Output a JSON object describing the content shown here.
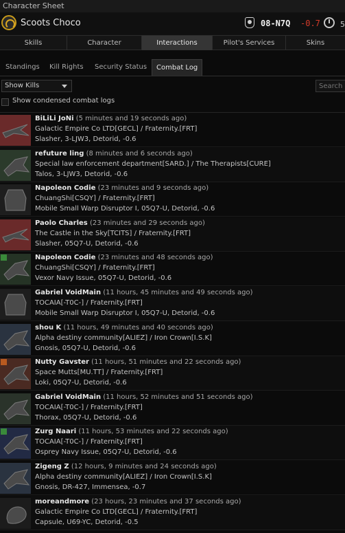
{
  "window": {
    "title": "Character Sheet"
  },
  "header": {
    "character_name": "Scoots Choco",
    "system": "08-N7Q",
    "system_security": "-0.7",
    "clock_value": "5"
  },
  "main_tabs": [
    {
      "label": "Skills",
      "active": false
    },
    {
      "label": "Character",
      "active": false
    },
    {
      "label": "Interactions",
      "active": true
    },
    {
      "label": "Pilot's Services",
      "active": false
    },
    {
      "label": "Skins",
      "active": false
    }
  ],
  "sub_tabs": [
    {
      "label": "Standings",
      "active": false
    },
    {
      "label": "Kill Rights",
      "active": false
    },
    {
      "label": "Security Status",
      "active": false
    },
    {
      "label": "Combat Log",
      "active": true
    }
  ],
  "controls": {
    "filter_value": "Show Kills",
    "search_placeholder": "Search",
    "condensed_label": "Show condensed combat logs",
    "condensed_checked": false
  },
  "kills": [
    {
      "pilot": "BiLiLi JoNi",
      "time": "(5 minutes and 19 seconds ago)",
      "corp": "Galactic Empire Co LTD[GECL] / Fraternity.[FRT]",
      "details": "Slasher, 3-LJW3, Detorid, -0.6",
      "ship_icon": "slasher-ship-icon",
      "tint": "#6a2a2a"
    },
    {
      "pilot": "refuture ling",
      "time": "(8 minutes and 6 seconds ago)",
      "corp": "Special law enforcement department[SARD.] / The Therapists[CURE]",
      "details": "Talos, 3-LJW3, Detorid, -0.6",
      "ship_icon": "talos-ship-icon",
      "tint": "#2b3a2b"
    },
    {
      "pilot": "Napoleon Codie",
      "time": "(23 minutes and 9 seconds ago)",
      "corp": "ChuangShi[CSQY] / Fraternity.[FRT]",
      "details": "Mobile Small Warp Disruptor I, 05Q7-U, Detorid, -0.6",
      "ship_icon": "warp-disruptor-icon",
      "tint": "#1e1e1e"
    },
    {
      "pilot": "Paolo Charles",
      "time": "(23 minutes and 29 seconds ago)",
      "corp": "The Castle in the Sky[TCITS] / Fraternity.[FRT]",
      "details": "Slasher, 05Q7-U, Detorid, -0.6",
      "ship_icon": "slasher-ship-icon",
      "tint": "#6a2a2a"
    },
    {
      "pilot": "Napoleon Codie",
      "time": "(23 minutes and 48 seconds ago)",
      "corp": "ChuangShi[CSQY] / Fraternity.[FRT]",
      "details": "Vexor Navy Issue, 05Q7-U, Detorid, -0.6",
      "ship_icon": "vexor-ship-icon",
      "tint": "#253325",
      "badge": "#3a8a3a"
    },
    {
      "pilot": "Gabriel VoidMain",
      "time": "(11 hours, 45 minutes and 49 seconds ago)",
      "corp": "TOCAIA[-T0C-] / Fraternity.[FRT]",
      "details": "Mobile Small Warp Disruptor I, 05Q7-U, Detorid, -0.6",
      "ship_icon": "warp-disruptor-icon",
      "tint": "#1e1e1e"
    },
    {
      "pilot": "shou K",
      "time": "(11 hours, 49 minutes and 40 seconds ago)",
      "corp": "Alpha destiny community[ALIEZ] / Iron Crown[I.S.K]",
      "details": "Gnosis, 05Q7-U, Detorid, -0.6",
      "ship_icon": "gnosis-ship-icon",
      "tint": "#2a3340"
    },
    {
      "pilot": "Nutty Gavster",
      "time": "(11 hours, 51 minutes and 22 seconds ago)",
      "corp": "Space Mutts[MU.TT] / Fraternity.[FRT]",
      "details": "Loki, 05Q7-U, Detorid, -0.6",
      "ship_icon": "loki-ship-icon",
      "tint": "#4a2a22",
      "badge": "#b85a20"
    },
    {
      "pilot": "Gabriel VoidMain",
      "time": "(11 hours, 52 minutes and 51 seconds ago)",
      "corp": "TOCAIA[-T0C-] / Fraternity.[FRT]",
      "details": "Thorax, 05Q7-U, Detorid, -0.6",
      "ship_icon": "thorax-ship-icon",
      "tint": "#2a332a"
    },
    {
      "pilot": "Zurg Naari",
      "time": "(11 hours, 53 minutes and 22 seconds ago)",
      "corp": "TOCAIA[-T0C-] / Fraternity.[FRT]",
      "details": "Osprey Navy Issue, 05Q7-U, Detorid, -0.6",
      "ship_icon": "osprey-ship-icon",
      "tint": "#222a44",
      "badge": "#3a8a3a"
    },
    {
      "pilot": "Zigeng Z",
      "time": "(12 hours, 9 minutes and 24 seconds ago)",
      "corp": "Alpha destiny community[ALIEZ] / Iron Crown[I.S.K]",
      "details": "Gnosis, DR-427, Immensea, -0.7",
      "ship_icon": "gnosis-ship-icon",
      "tint": "#2a3340"
    },
    {
      "pilot": "moreandmore",
      "time": "(23 hours, 23 minutes and 37 seconds ago)",
      "corp": "Galactic Empire Co LTD[GECL] / Fraternity.[FRT]",
      "details": "Capsule, U69-YC, Detorid, -0.5",
      "ship_icon": "capsule-icon",
      "tint": "#1c1c1c"
    }
  ]
}
